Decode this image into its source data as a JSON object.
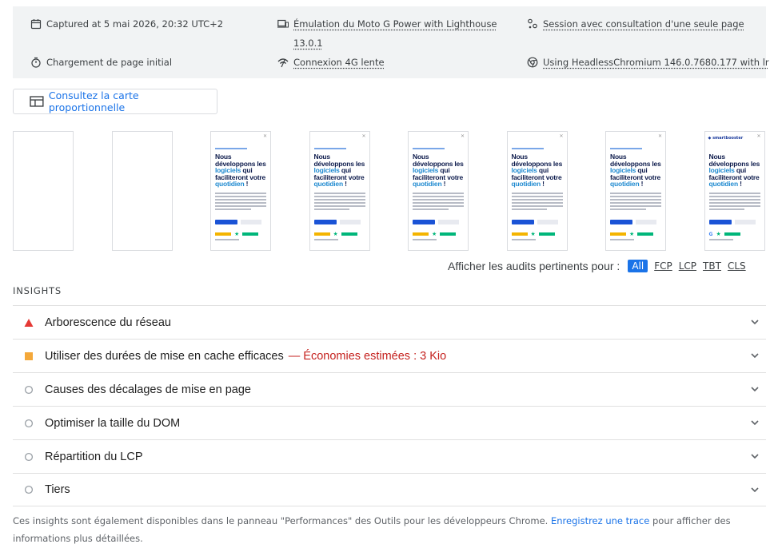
{
  "environment": {
    "captured": "Captured at 5 mai 2026, 20:32 UTC+2",
    "emulation": "Émulation du Moto G Power with Lighthouse 13.0.1",
    "session": "Session avec consultation d'une seule page",
    "load": "Chargement de page initial",
    "network": "Connexion 4G lente",
    "browser": "Using HeadlessChromium 146.0.7680.177 with lr"
  },
  "treemap_button": "Consultez la carte proportionnelle",
  "filmstrip": {
    "headline_pre": "Nous développons les",
    "headline_hl1": "logiciels",
    "headline_mid": "qui faciliteront votre",
    "headline_hl2": "quotidien",
    "headline_end": " !",
    "logo": "smartbooster",
    "frames": [
      {
        "state": "blank"
      },
      {
        "state": "blank"
      },
      {
        "state": "content"
      },
      {
        "state": "content"
      },
      {
        "state": "content"
      },
      {
        "state": "content"
      },
      {
        "state": "content"
      },
      {
        "state": "content-logo"
      }
    ]
  },
  "filter": {
    "label": "Afficher les audits pertinents pour :",
    "options": [
      "All",
      "FCP",
      "LCP",
      "TBT",
      "CLS"
    ],
    "active": "All"
  },
  "insights": {
    "title": "INSIGHTS",
    "items": [
      {
        "title": "Arborescence du réseau",
        "status": "fail",
        "savings": ""
      },
      {
        "title": "Utiliser des durées de mise en cache efficaces",
        "status": "average",
        "savings": "— Économies estimées : 3 Kio"
      },
      {
        "title": "Causes des décalages de mise en page",
        "status": "neutral",
        "savings": ""
      },
      {
        "title": "Optimiser la taille du DOM",
        "status": "neutral",
        "savings": ""
      },
      {
        "title": "Répartition du LCP",
        "status": "neutral",
        "savings": ""
      },
      {
        "title": "Tiers",
        "status": "neutral",
        "savings": ""
      }
    ]
  },
  "footer": {
    "before": "Ces insights sont également disponibles dans le panneau \"Performances\" des Outils pour les développeurs Chrome.",
    "link": "Enregistrez une trace",
    "after": "pour afficher des informations plus détaillées."
  },
  "colors": {
    "fail": "#e53935",
    "average": "#f4a83a",
    "accent": "#1a73e8",
    "savings": "#c5221f"
  }
}
